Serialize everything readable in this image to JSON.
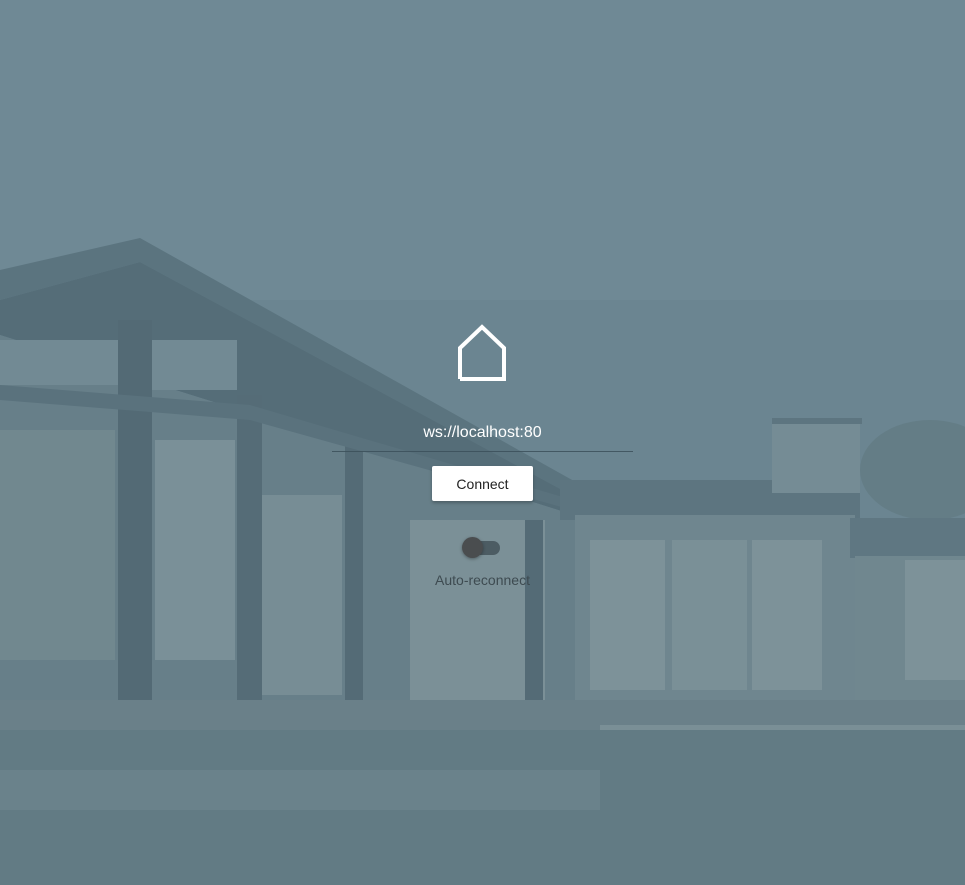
{
  "login": {
    "logo_icon": "house-outline-icon",
    "server_url": "ws://localhost:80",
    "connect_label": "Connect",
    "auto_reconnect_label": "Auto-reconnect",
    "auto_reconnect_enabled": false
  },
  "colors": {
    "overlay": "#6b8591",
    "icon_stroke": "#ffffff",
    "button_bg": "#ffffff",
    "toggle_knob": "#4a4d4f"
  }
}
